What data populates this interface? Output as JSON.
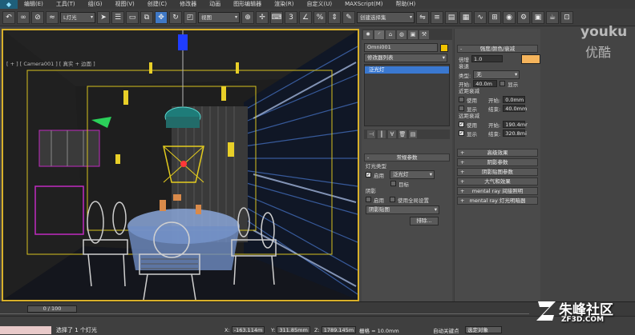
{
  "menubar": {
    "items": [
      "编辑(E)",
      "工具(T)",
      "组(G)",
      "视图(V)",
      "创建(C)",
      "修改器",
      "动画",
      "图形编辑器",
      "渲染(R)",
      "自定义(U)",
      "MAXScript(M)",
      "帮助(H)"
    ]
  },
  "toolbar": {
    "layer_filter": "L灯光",
    "view_mode": "视图",
    "selection_set": "创建选择集"
  },
  "viewport": {
    "label": "[ + ] [ Camera001 ] [ 真实 + 边面 ]"
  },
  "command_panel": {
    "object_name": "Omni001",
    "modifier_list": "修改器列表",
    "stack_item": "泛光灯",
    "general_params": {
      "title": "常规参数",
      "light_type_label": "灯光类型",
      "enabled_label": "启用",
      "light_type_value": "泛光灯",
      "target_label": "目标",
      "shadows_label": "阴影",
      "shadows_enabled_label": "启用",
      "use_global_label": "使用全局设置",
      "shadow_type": "阴影贴图",
      "exclude_button": "排除..."
    }
  },
  "intensity_panel": {
    "title": "强度/颜色/衰减",
    "multiplier_label": "倍增",
    "multiplier_value": "1.0",
    "decay_label": "衰退",
    "type_label": "类型:",
    "type_value": "无",
    "start_label": "开始:",
    "start_value": "40.0m",
    "show_label": "显示",
    "near_atten_label": "近距衰减",
    "near_use_label": "使用",
    "near_start_label": "开始:",
    "near_start_value": "0.0mm",
    "near_show_label": "显示",
    "near_end_label": "结束:",
    "near_end_value": "40.0mm",
    "far_atten_label": "远距衰减",
    "far_use_label": "使用",
    "far_start_label": "开始:",
    "far_start_value": "190.4mr",
    "far_show_label": "显示",
    "far_end_label": "结束:",
    "far_end_value": "320.8mi",
    "rollouts": [
      "高级效果",
      "阴影参数",
      "阴影贴图参数",
      "大气和效果",
      "mental ray 间接照明",
      "mental ray 灯光明暗器"
    ],
    "light_color": "#f5b45c"
  },
  "timeline": {
    "frame": "0 / 100"
  },
  "status": {
    "message": "选择了 1 个灯光",
    "x_label": "X:",
    "x_value": "-163.114m",
    "y_label": "Y:",
    "y_value": "311.85mm",
    "z_label": "Z:",
    "z_value": "1789.145m",
    "grid": "栅格 = 10.0mm",
    "autokey": "自动关键点",
    "selected_objects": "选定对象"
  },
  "watermarks": {
    "youku_top": "youku",
    "youku_cn": "优酷",
    "zf_text": "朱峰社区",
    "zf_url": "ZF3D.COM"
  }
}
